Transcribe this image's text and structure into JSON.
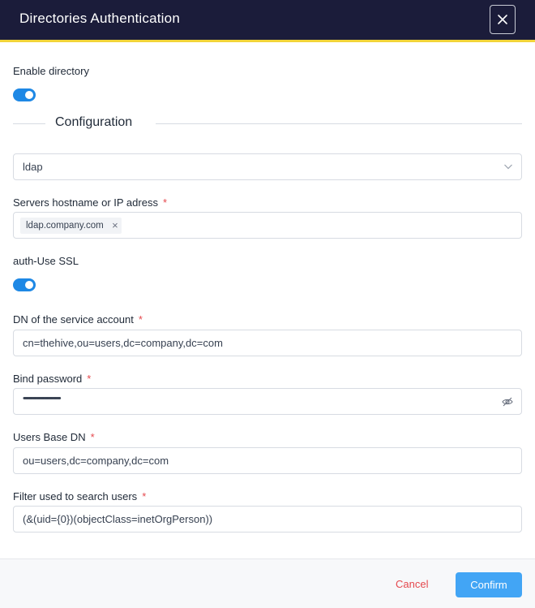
{
  "dialog": {
    "title": "Directories Authentication",
    "close_icon": "close-icon"
  },
  "enable_directory": {
    "label": "Enable directory",
    "enabled": true
  },
  "section": {
    "title": "Configuration"
  },
  "provider_select": {
    "value": "ldap"
  },
  "servers": {
    "label": "Servers hostname or IP adress",
    "required_mark": "*",
    "tags": [
      "ldap.company.com"
    ],
    "tag_remove_glyph": "×"
  },
  "use_ssl": {
    "label": "auth-Use SSL",
    "enabled": true
  },
  "service_account": {
    "label": "DN of the service account",
    "required_mark": "*",
    "value": "cn=thehive,ou=users,dc=company,dc=com"
  },
  "bind_password": {
    "label": "Bind password",
    "required_mark": "*",
    "value": "••••••••••••••••••••••••••••••••••••",
    "visibility_icon": "eye-off-icon"
  },
  "users_base_dn": {
    "label": "Users Base DN",
    "required_mark": "*",
    "value": "ou=users,dc=company,dc=com"
  },
  "search_filter": {
    "label": "Filter used to search users",
    "required_mark": "*",
    "value": "(&(uid={0})(objectClass=inetOrgPerson))"
  },
  "footer": {
    "cancel_label": "Cancel",
    "confirm_label": "Confirm"
  },
  "colors": {
    "header_bg": "#1b1c3a",
    "header_accent": "#f2d43a",
    "toggle_on": "#1e88e5",
    "confirm_bg": "#42a5f5",
    "cancel_text": "#e5484d"
  }
}
